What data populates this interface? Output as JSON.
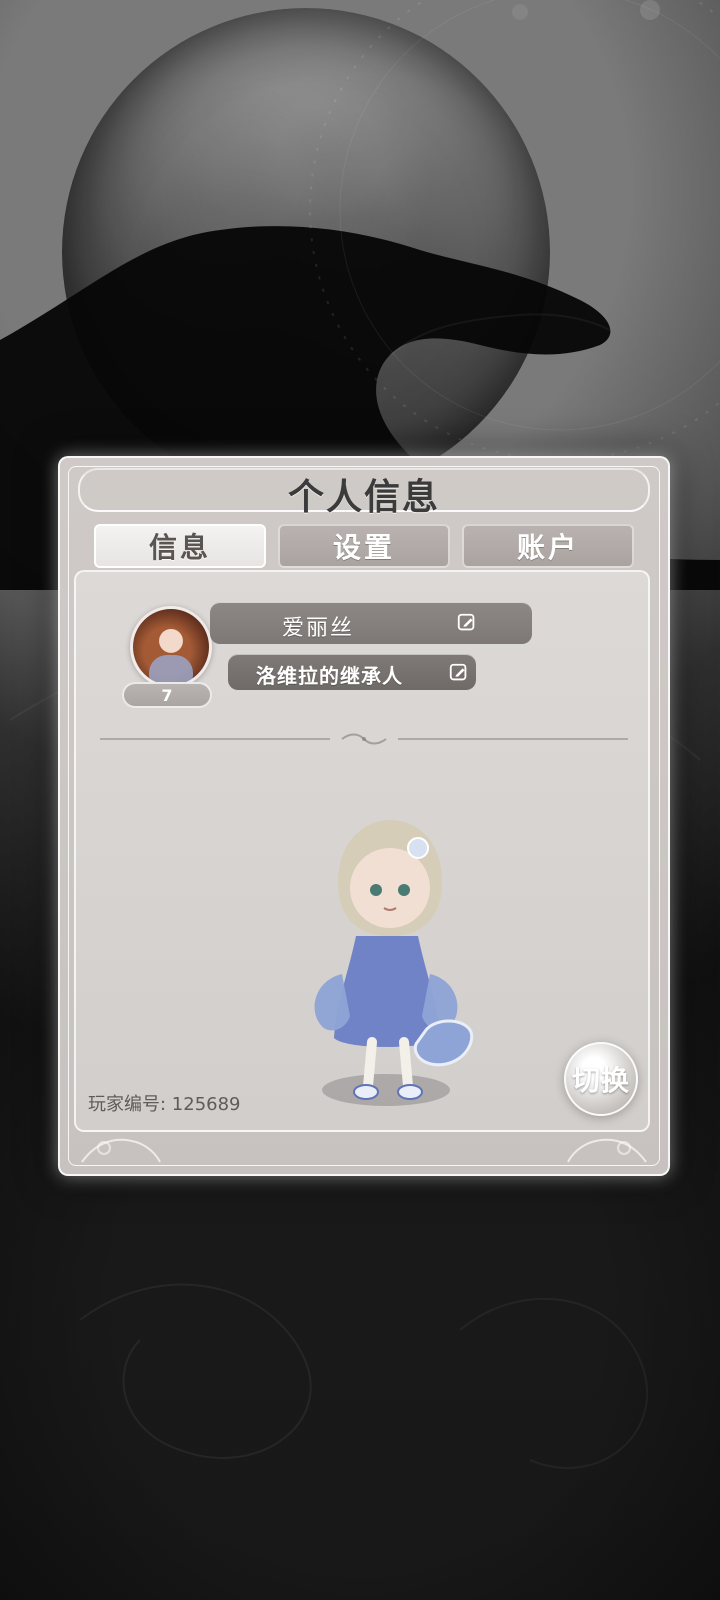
{
  "panel": {
    "title": "个人信息",
    "tabs": [
      {
        "label": "信息",
        "active": true
      },
      {
        "label": "设置",
        "active": false
      },
      {
        "label": "账户",
        "active": false
      }
    ]
  },
  "profile": {
    "name": "爱丽丝",
    "title": "洛维拉的继承人",
    "level": "7",
    "player_id_label": "玩家编号: 125689",
    "switch_label": "切换"
  }
}
